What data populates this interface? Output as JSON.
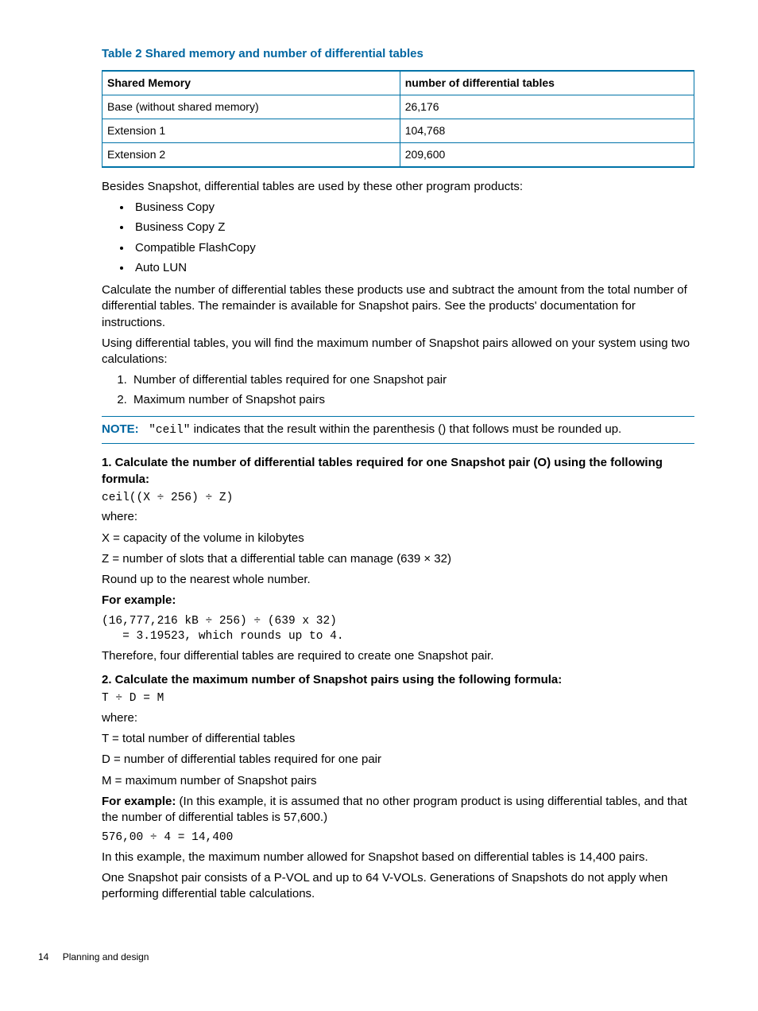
{
  "table": {
    "title": "Table 2 Shared memory and number of differential tables",
    "headers": [
      "Shared Memory",
      "number of differential tables"
    ],
    "rows": [
      [
        "Base (without shared memory)",
        "26,176"
      ],
      [
        "Extension 1",
        "104,768"
      ],
      [
        "Extension 2",
        "209,600"
      ]
    ]
  },
  "para1": "Besides Snapshot, differential tables are used by these other program products:",
  "bullets": [
    "Business Copy",
    "Business Copy Z",
    "Compatible FlashCopy",
    "Auto LUN"
  ],
  "para2": "Calculate the number of differential tables these products use and subtract the amount from the total number of differential tables. The remainder is available for Snapshot pairs. See the products' documentation for instructions.",
  "para3": "Using differential tables, you will find the maximum number of Snapshot pairs allowed on your system using two calculations:",
  "numbered": [
    "Number of differential tables required for one Snapshot pair",
    "Maximum number of Snapshot pairs"
  ],
  "note": {
    "label": "NOTE:",
    "code": "\"ceil\"",
    "text": " indicates that the result within the parenthesis () that follows must be rounded up."
  },
  "step1": {
    "heading": "1. Calculate the number of differential tables required for one Snapshot pair (O) using the following formula:",
    "formula": "ceil((X ÷ 256) ÷ Z)",
    "where": "where:",
    "x": "X = capacity of the volume in kilobytes",
    "z": "Z = number of slots that a differential table can manage (639 × 32)",
    "round": "Round up to the nearest whole number.",
    "example_label": "For example:",
    "example_code": "(16,777,216 kB ÷ 256) ÷ (639 x 32)\n   = 3.19523, which rounds up to 4.",
    "therefore": "Therefore, four differential tables are required to create one Snapshot pair."
  },
  "step2": {
    "heading": "2. Calculate the maximum number of Snapshot pairs using the following formula:",
    "formula": "T ÷ D = M",
    "where": "where:",
    "t": "T = total number of differential tables",
    "d": "D = number of differential tables required for one pair",
    "m": "M = maximum number of Snapshot pairs",
    "example_label": "For example:",
    "example_text": " (In this example, it is assumed that no other program product is using differential tables, and that the number of differential tables is 57,600.)",
    "example_code": "576,00 ÷ 4 = 14,400",
    "result": "In this example, the maximum number allowed for Snapshot based on differential tables is 14,400 pairs.",
    "tail": "One Snapshot pair consists of a P-VOL and up to 64 V-VOLs. Generations of Snapshots do not apply when performing differential table calculations."
  },
  "footer": {
    "page": "14",
    "section": "Planning and design"
  }
}
